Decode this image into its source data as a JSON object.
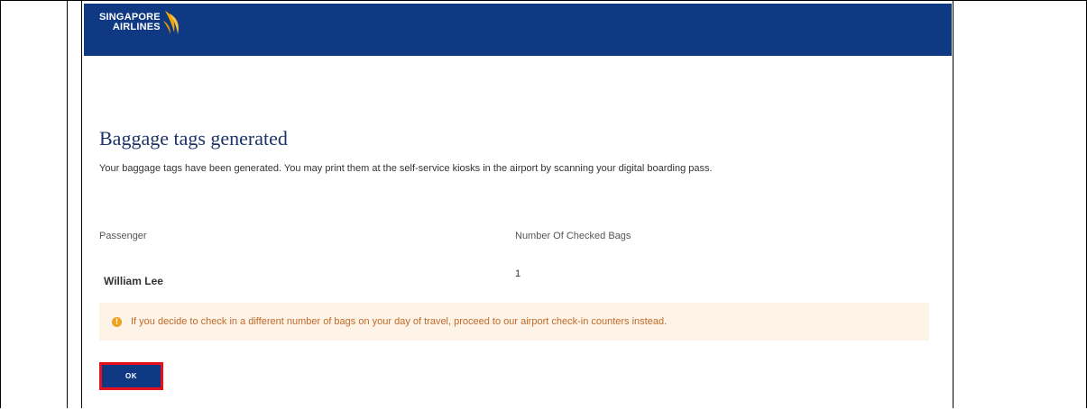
{
  "brand": {
    "line1": "SINGAPORE",
    "line2": "AIRLINES"
  },
  "heading": "Baggage tags generated",
  "description": "Your baggage tags have been generated. You may print them at the self-service kiosks in the airport by scanning your digital boarding pass.",
  "table": {
    "headers": [
      "Passenger",
      "Number Of Checked Bags"
    ],
    "rows": [
      {
        "passenger": "William Lee",
        "bags": "1"
      }
    ]
  },
  "alert": {
    "icon": "exclamation-icon",
    "text": "If you decide to check in a different number of bags on your day of travel, proceed to our airport check-in counters instead."
  },
  "ok_button": "OK",
  "colors": {
    "header": "#0f3a83",
    "accent_gold": "#f2a900",
    "alert_bg": "#fdf3e6",
    "highlight": "#e8101c"
  }
}
